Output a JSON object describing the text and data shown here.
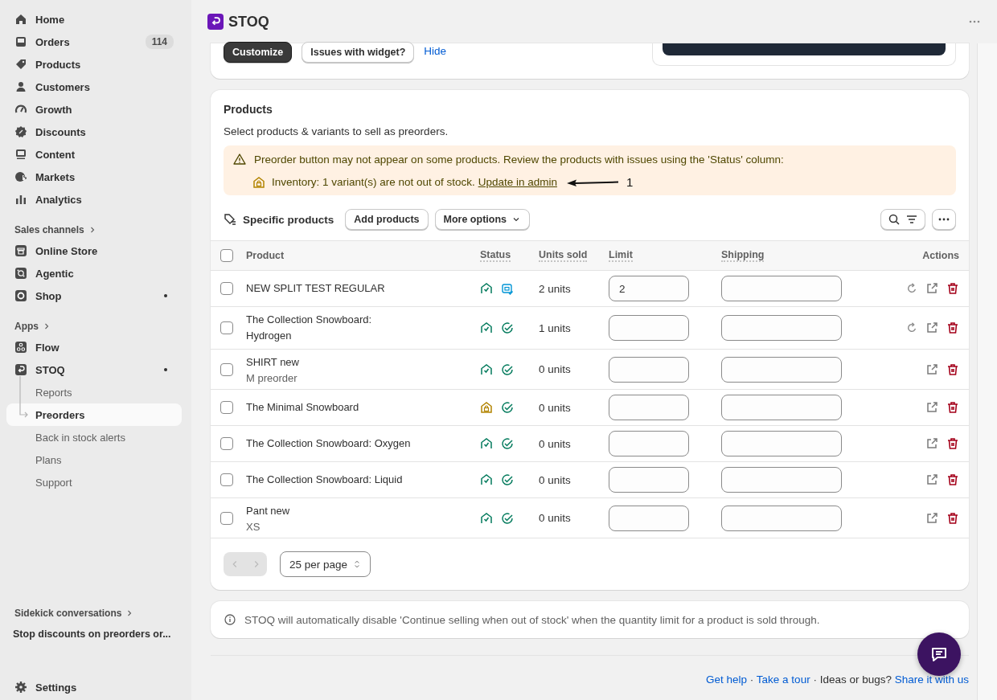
{
  "sidebar": {
    "main_items": [
      {
        "label": "Home",
        "selected": false
      },
      {
        "label": "Orders",
        "selected": false,
        "badge": "114"
      },
      {
        "label": "Products",
        "selected": false
      },
      {
        "label": "Customers",
        "selected": false
      },
      {
        "label": "Growth",
        "selected": false
      },
      {
        "label": "Discounts",
        "selected": false
      },
      {
        "label": "Content",
        "selected": false
      },
      {
        "label": "Markets",
        "selected": false
      },
      {
        "label": "Analytics",
        "selected": false
      }
    ],
    "sales_channels": {
      "heading": "Sales channels",
      "items": [
        {
          "label": "Online Store",
          "selected": false,
          "dot": false
        },
        {
          "label": "Agentic",
          "selected": false,
          "dot": false
        },
        {
          "label": "Shop",
          "selected": false,
          "dot": true
        }
      ]
    },
    "apps": {
      "heading": "Apps",
      "items": [
        {
          "label": "Flow",
          "selected": false,
          "dot": false
        },
        {
          "label": "STOQ",
          "selected": false,
          "dot": true,
          "children": [
            {
              "label": "Reports",
              "selected": false
            },
            {
              "label": "Preorders",
              "selected": true
            },
            {
              "label": "Back in stock alerts",
              "selected": false
            },
            {
              "label": "Plans",
              "selected": false
            },
            {
              "label": "Support",
              "selected": false
            }
          ]
        }
      ]
    },
    "sidekick": {
      "heading": "Sidekick conversations",
      "items": [
        "Stop discounts on preorders or..."
      ]
    },
    "settings": "Settings"
  },
  "app_bar": {
    "title": "STOQ"
  },
  "widget_card": {
    "buttons": [
      "Customize",
      "Issues with widget?"
    ],
    "link": "Hide"
  },
  "products_card": {
    "title": "Products",
    "subtitle": "Select products & variants to sell as preorders.",
    "alert": {
      "message": "Preorder button may not appear on some products. Review the products with issues using the 'Status' column:",
      "issue": "Inventory: 1 variant(s) are not out of stock.",
      "link": "Update in admin",
      "annotation": "1"
    },
    "toolbar": {
      "label": "Specific products",
      "buttons": [
        "Add products",
        "More options"
      ]
    },
    "table": {
      "select_all_checked": false,
      "columns": [
        {
          "label": "Product",
          "hint": false
        },
        {
          "label": "Status",
          "hint": true
        },
        {
          "label": "Units sold",
          "hint": true
        },
        {
          "label": "Limit",
          "hint": true
        },
        {
          "label": "Shipping",
          "hint": true
        },
        {
          "label": "Actions",
          "hint": false
        }
      ],
      "rows": [
        {
          "checked": false,
          "name": "NEW SPLIT TEST REGULAR",
          "inventory_issue": false,
          "scheduled": true,
          "units_sold": "2 units",
          "limit": "2",
          "can_refresh": true
        },
        {
          "checked": false,
          "name": "The Collection Snowboard: Hydrogen",
          "inventory_issue": false,
          "scheduled": false,
          "units_sold": "1 units",
          "limit": "",
          "can_refresh": true
        },
        {
          "checked": false,
          "name": "SHIRT new",
          "variant": "M preorder",
          "inventory_issue": false,
          "scheduled": false,
          "units_sold": "0 units",
          "limit": "",
          "can_refresh": false
        },
        {
          "checked": false,
          "name": "The Minimal Snowboard",
          "inventory_issue": true,
          "scheduled": false,
          "units_sold": "0 units",
          "limit": "",
          "can_refresh": false
        },
        {
          "checked": false,
          "name": "The Collection Snowboard: Oxygen",
          "inventory_issue": false,
          "scheduled": false,
          "units_sold": "0 units",
          "limit": "",
          "can_refresh": false
        },
        {
          "checked": false,
          "name": "The Collection Snowboard: Liquid",
          "inventory_issue": false,
          "scheduled": false,
          "units_sold": "0 units",
          "limit": "",
          "can_refresh": false
        },
        {
          "checked": false,
          "name": "Pant new",
          "variant": "XS",
          "inventory_issue": false,
          "scheduled": false,
          "units_sold": "0 units",
          "limit": "",
          "can_refresh": false
        }
      ]
    },
    "pagination": {
      "previous_disabled": true,
      "next_disabled": true,
      "per_page": "25 per page"
    }
  },
  "info_note": "STOQ will automatically disable 'Continue selling when out of stock' when the quantity limit for a product is sold through.",
  "footer": [
    {
      "kind": "link",
      "text": "Get help"
    },
    {
      "kind": "text",
      "text": " · "
    },
    {
      "kind": "link",
      "text": "Take a tour"
    },
    {
      "kind": "text",
      "text": " · Ideas or bugs? "
    },
    {
      "kind": "link",
      "text": "Share it with us"
    }
  ]
}
